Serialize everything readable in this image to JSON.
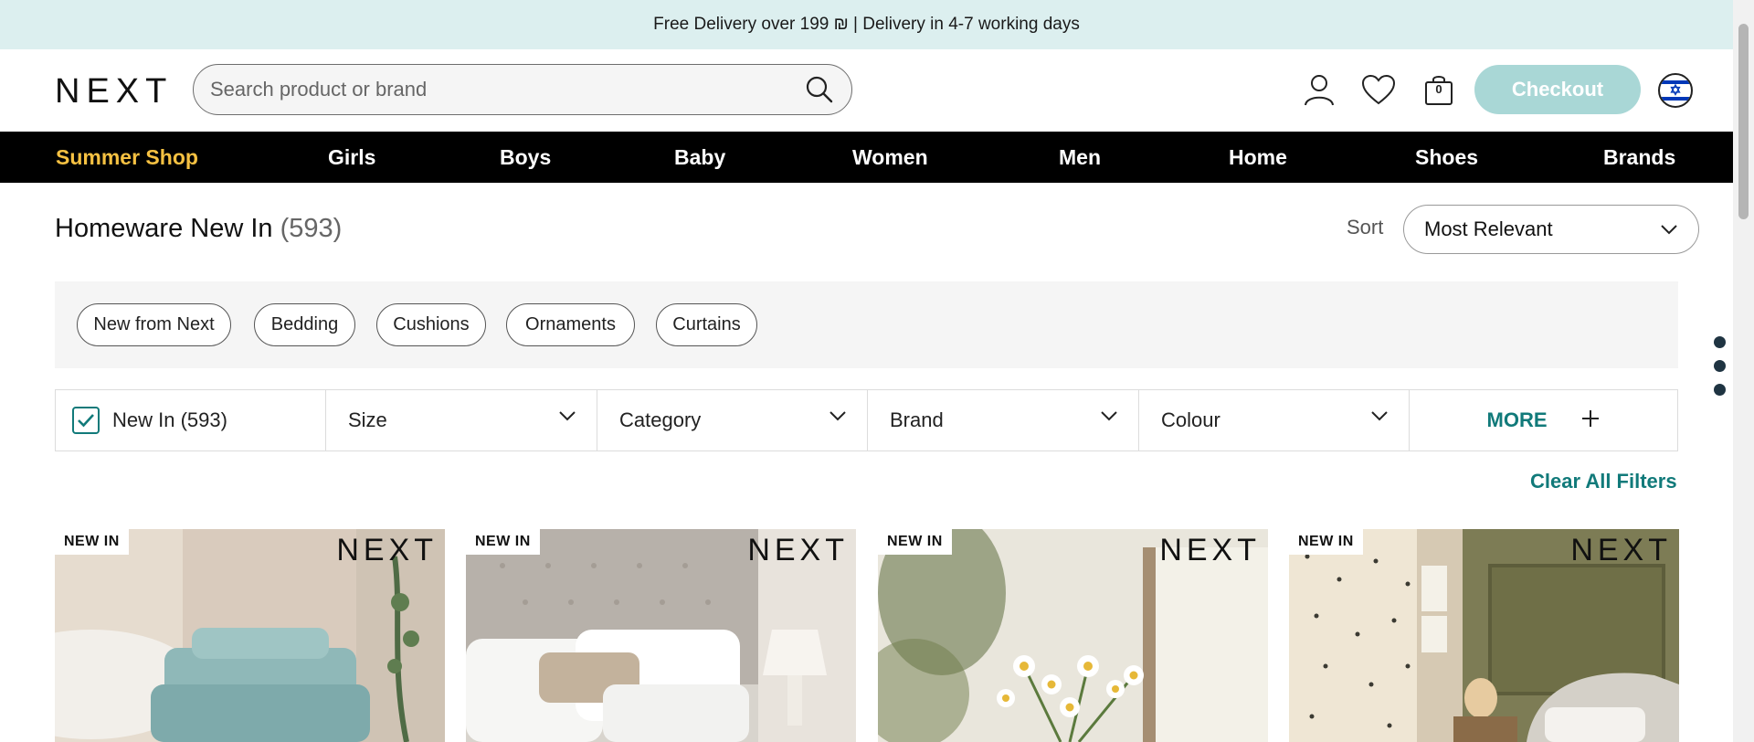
{
  "promo": {
    "text": "Free Delivery over 199 ₪ | Delivery in 4-7 working days"
  },
  "header": {
    "logo": "NEXT",
    "search_placeholder": "Search product or brand",
    "bag_count": "0",
    "checkout_label": "Checkout"
  },
  "nav": {
    "items": [
      "Summer Shop",
      "Girls",
      "Boys",
      "Baby",
      "Women",
      "Men",
      "Home",
      "Shoes",
      "Brands"
    ],
    "highlight_color": "#f6c142"
  },
  "page": {
    "title": "Homeware New In",
    "count": "(593)"
  },
  "sort": {
    "label": "Sort",
    "selected": "Most Relevant"
  },
  "chips": [
    "New from Next",
    "Bedding",
    "Cushions",
    "Ornaments",
    "Curtains"
  ],
  "filters": {
    "new_in": "New In (593)",
    "size": "Size",
    "category": "Category",
    "brand": "Brand",
    "colour": "Colour",
    "more": "MORE"
  },
  "clear_all": "Clear All Filters",
  "products": [
    {
      "badge": "NEW IN",
      "brand": "NEXT"
    },
    {
      "badge": "NEW IN",
      "brand": "NEXT"
    },
    {
      "badge": "NEW IN",
      "brand": "NEXT"
    },
    {
      "badge": "NEW IN",
      "brand": "NEXT"
    }
  ],
  "colors": {
    "accent": "#117a7a",
    "checkout_bg": "#a9d7d6",
    "promo_bg": "#dcefef"
  }
}
